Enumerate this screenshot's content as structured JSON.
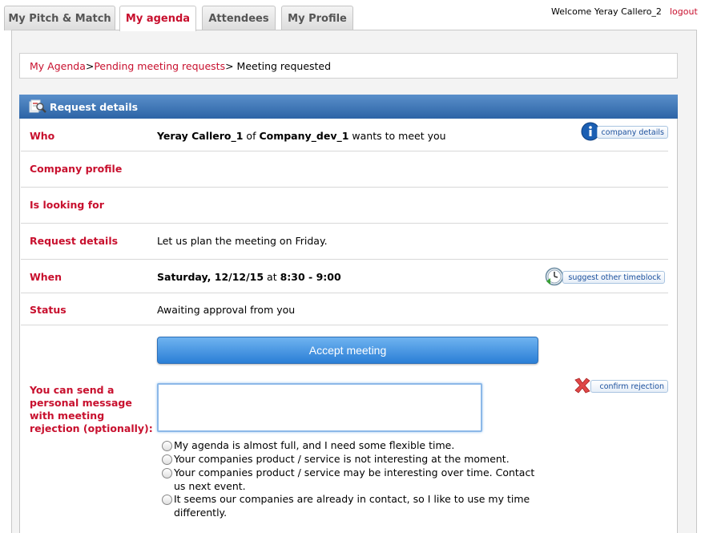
{
  "tabs": [
    {
      "label": "My Pitch & Match"
    },
    {
      "label": "My agenda"
    },
    {
      "label": "Attendees"
    },
    {
      "label": "My Profile"
    }
  ],
  "header": {
    "welcome": "Welcome Yeray Callero_2",
    "logout": "logout"
  },
  "breadcrumb": {
    "item1": "My Agenda",
    "sep1": ">",
    "item2": "Pending meeting requests",
    "sep2": ">",
    "current": " Meeting requested"
  },
  "panel": {
    "title": "Request details",
    "rows": {
      "who": {
        "label": "Who",
        "person": "Yeray Callero_1",
        "of": " of ",
        "company": "Company_dev_1",
        "suffix": " wants to meet you",
        "action": "company details"
      },
      "company_profile": {
        "label": "Company profile"
      },
      "looking_for": {
        "label": "Is looking for"
      },
      "request_details": {
        "label": "Request details",
        "value": "Let us plan the meeting on Friday."
      },
      "when": {
        "label": "When",
        "date": "Saturday, 12/12/15",
        "at": " at ",
        "time": "8:30 - 9:00",
        "action": "suggest other timeblock"
      },
      "status": {
        "label": "Status",
        "value": "Awaiting approval from you"
      }
    },
    "accept_button": "Accept meeting",
    "rejection": {
      "label": "You can send a personal message with meeting rejection (optionally):",
      "message_value": "",
      "confirm_button": "confirm rejection",
      "options": [
        {
          "label": "My agenda is almost full, and I need some flexible time."
        },
        {
          "label": "Your companies product / service is not interesting at the moment."
        },
        {
          "label": "Your companies product / service may be interesting over time. Contact us next event."
        },
        {
          "label": "It seems our companies are already in contact, so I like to use my time differently."
        }
      ]
    }
  },
  "colors": {
    "accent_red": "#c8102e",
    "header_blue": "#2c64a6",
    "button_blue": "#2b7fd6",
    "link_blue": "#1a4f9c"
  }
}
